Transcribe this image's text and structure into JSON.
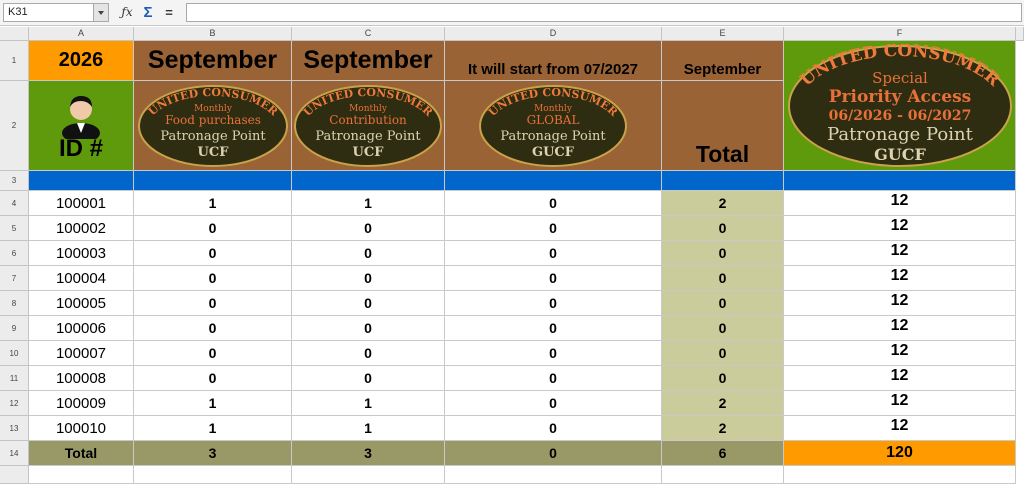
{
  "formula_bar": {
    "cell_ref": "K31",
    "fx_icon": "function-wizard-icon",
    "sum_icon": "sum-icon",
    "equals_label": "=",
    "formula": ""
  },
  "columns": [
    "A",
    "B",
    "C",
    "D",
    "E",
    "F"
  ],
  "rows": [
    "1",
    "2",
    "3",
    "4",
    "5",
    "6",
    "7",
    "8",
    "9",
    "10",
    "11",
    "12",
    "13",
    "14",
    ""
  ],
  "header": {
    "year": "2026",
    "b1": "September",
    "c1": "September",
    "d1": "It will start from 07/2027",
    "e1": "September",
    "id_label": "ID #",
    "total_label": "Total"
  },
  "badges": {
    "b": {
      "arc": "UNITED CONSUMER",
      "line1": "Monthly",
      "line2": "Food purchases",
      "line3": "Patronage Point",
      "line4": "UCF"
    },
    "c": {
      "arc": "UNITED CONSUMER",
      "line1": "Monthly",
      "line2": "Contribution",
      "line3": "Patronage Point",
      "line4": "UCF"
    },
    "d": {
      "arc": "UNITED CONSUMER",
      "line1": "Monthly",
      "line2": "GLOBAL",
      "line3": "Patronage Point",
      "line4": "GUCF"
    },
    "f": {
      "arc": "UNITED CONSUMER",
      "line1": "Special",
      "line2": "Priority Access",
      "line3": "06/2026 - 06/2027",
      "line4": "Patronage Point",
      "line5": "GUCF"
    }
  },
  "data_rows": [
    {
      "id": "100001",
      "b": "1",
      "c": "1",
      "d": "0",
      "e": "2",
      "f": "12"
    },
    {
      "id": "100002",
      "b": "0",
      "c": "0",
      "d": "0",
      "e": "0",
      "f": "12"
    },
    {
      "id": "100003",
      "b": "0",
      "c": "0",
      "d": "0",
      "e": "0",
      "f": "12"
    },
    {
      "id": "100004",
      "b": "0",
      "c": "0",
      "d": "0",
      "e": "0",
      "f": "12"
    },
    {
      "id": "100005",
      "b": "0",
      "c": "0",
      "d": "0",
      "e": "0",
      "f": "12"
    },
    {
      "id": "100006",
      "b": "0",
      "c": "0",
      "d": "0",
      "e": "0",
      "f": "12"
    },
    {
      "id": "100007",
      "b": "0",
      "c": "0",
      "d": "0",
      "e": "0",
      "f": "12"
    },
    {
      "id": "100008",
      "b": "0",
      "c": "0",
      "d": "0",
      "e": "0",
      "f": "12"
    },
    {
      "id": "100009",
      "b": "1",
      "c": "1",
      "d": "0",
      "e": "2",
      "f": "12"
    },
    {
      "id": "100010",
      "b": "1",
      "c": "1",
      "d": "0",
      "e": "2",
      "f": "12"
    }
  ],
  "totals": {
    "label": "Total",
    "b": "3",
    "c": "3",
    "d": "0",
    "e": "6",
    "f": "120"
  },
  "colors": {
    "year_bg": "#ff9a00",
    "header_brown": "#9a6336",
    "id_green": "#5f9a0d",
    "separator_blue": "#0066cc",
    "total_column": "#cbcc9b",
    "total_row": "#999967",
    "grand_total": "#ff9a00",
    "badge_fill": "#2e2d12",
    "badge_text": "#f07a3a"
  }
}
